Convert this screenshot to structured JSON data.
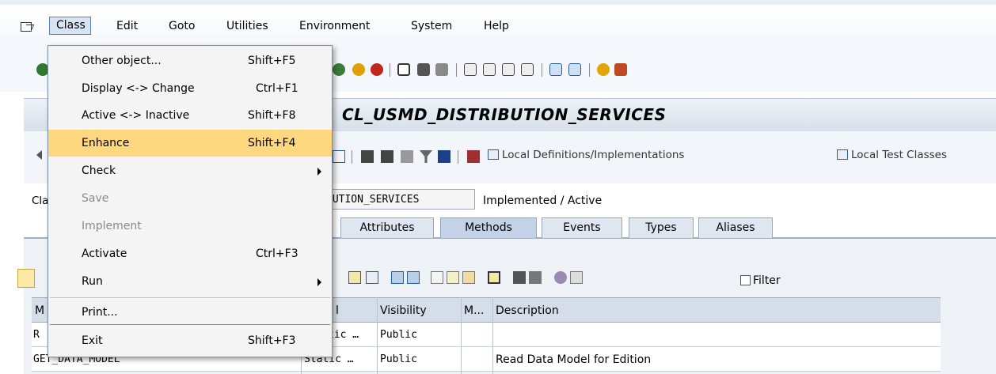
{
  "menubar": {
    "items": [
      {
        "label": "Class"
      },
      {
        "label": "Edit"
      },
      {
        "label": "Goto"
      },
      {
        "label": "Utilities"
      },
      {
        "label": "Environment"
      },
      {
        "label": "System"
      },
      {
        "label": "Help"
      }
    ]
  },
  "dropdown": {
    "items": [
      {
        "label": "Other object...",
        "shortcut": "Shift+F5"
      },
      {
        "label": "Display <-> Change",
        "shortcut": "Ctrl+F1"
      },
      {
        "label": "Active <-> Inactive",
        "shortcut": "Shift+F8"
      },
      {
        "label": "Enhance",
        "shortcut": "Shift+F4"
      },
      {
        "label": "Check",
        "shortcut": ""
      },
      {
        "label": "Save",
        "shortcut": ""
      },
      {
        "label": "Implement",
        "shortcut": ""
      },
      {
        "label": "Activate",
        "shortcut": "Ctrl+F3"
      },
      {
        "label": "Run",
        "shortcut": ""
      },
      {
        "label": "Print...",
        "shortcut": ""
      },
      {
        "label": "Exit",
        "shortcut": "Shift+F3"
      }
    ],
    "highlight_color": "#ffd77f"
  },
  "title": "CL_USMD_DISTRIBUTION_SERVICES",
  "app_toolbar": {
    "local_defs": "Local Definitions/Implementations",
    "local_tests": "Local Test Classes"
  },
  "class_info": {
    "label_fragment": "Cla",
    "name_fragment": "BUTION_SERVICES",
    "status": "Implemented / Active"
  },
  "tabs": [
    {
      "label": "Attributes"
    },
    {
      "label": "Methods"
    },
    {
      "label": "Events"
    },
    {
      "label": "Types"
    },
    {
      "label": "Aliases"
    }
  ],
  "filter_label": "Filter",
  "grid": {
    "headers": {
      "level": "l",
      "visibility": "Visibility",
      "m": "M...",
      "description": "Description",
      "first": "M"
    },
    "rows": [
      {
        "name": "R",
        "level": "tic  …",
        "visibility": "Public",
        "description": ""
      },
      {
        "name": "GET_DATA_MODEL",
        "level": "Static  …",
        "visibility": "Public",
        "description": "Read Data Model for Edition"
      }
    ]
  }
}
